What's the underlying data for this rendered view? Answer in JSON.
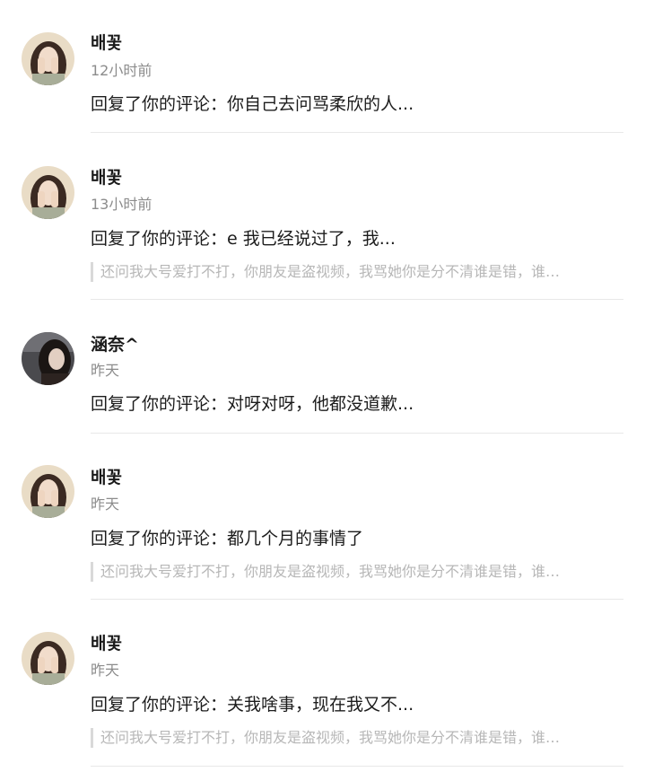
{
  "reply_prefix": "回复了你的评论：",
  "items": [
    {
      "name": "배꽃",
      "time": "12小时前",
      "reply": "你自己去问骂柔欣的人...",
      "quote": "",
      "avatar": "avatar-girl-light"
    },
    {
      "name": "배꽃",
      "time": "13小时前",
      "reply": "e 我已经说过了，我...",
      "quote": "还问我大号爱打不打，你朋友是盗视频，我骂她你是分不清谁是错，谁…",
      "avatar": "avatar-girl-light"
    },
    {
      "name": "涵奈^",
      "time": "昨天",
      "reply": "对呀对呀，他都没道歉...",
      "quote": "",
      "avatar": "avatar-girl-dark"
    },
    {
      "name": "배꽃",
      "time": "昨天",
      "reply": "都几个月的事情了",
      "quote": "还问我大号爱打不打，你朋友是盗视频，我骂她你是分不清谁是错，谁…",
      "avatar": "avatar-girl-light"
    },
    {
      "name": "배꽃",
      "time": "昨天",
      "reply": "关我啥事，现在我又不...",
      "quote": "还问我大号爱打不打，你朋友是盗视频，我骂她你是分不清谁是错，谁…",
      "avatar": "avatar-girl-light"
    }
  ],
  "colors": {
    "name": "#1a1a1a",
    "time": "#8c8c8c",
    "reply": "#1c1c1c",
    "quote": "#b7b7b7",
    "quote_bar": "#d9d9d9",
    "divider": "#e8e8e8"
  }
}
